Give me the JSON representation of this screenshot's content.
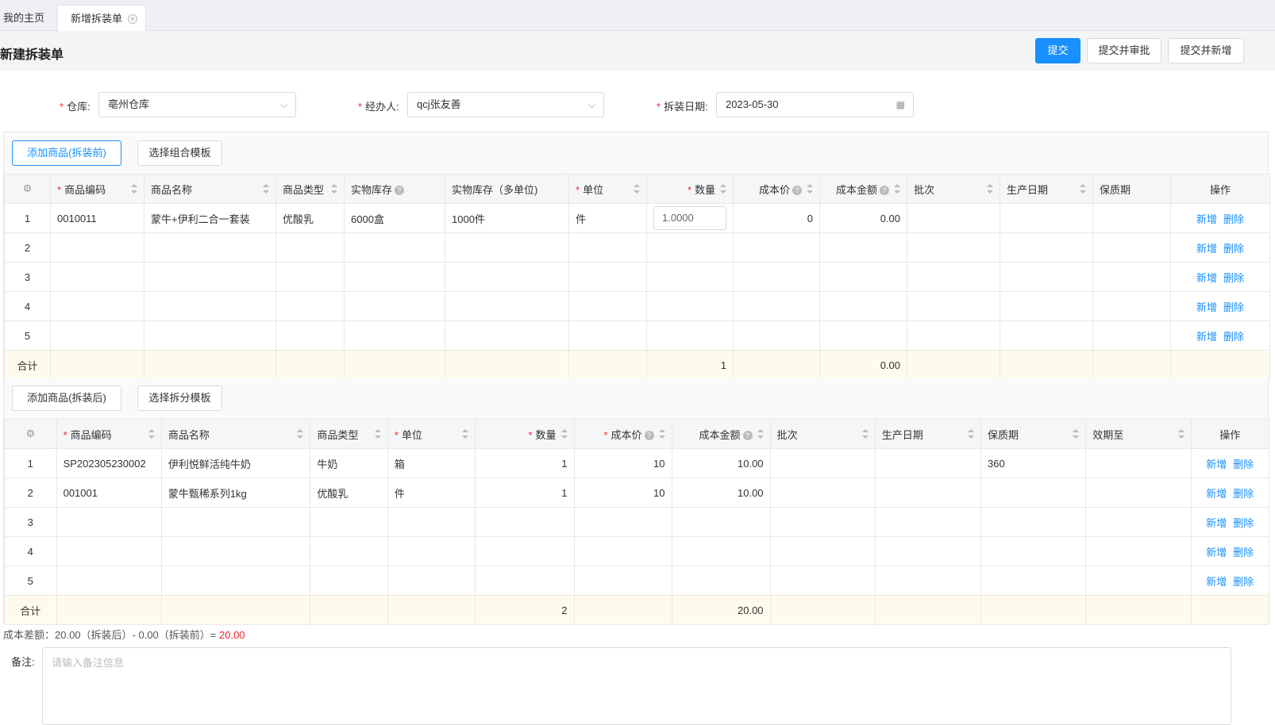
{
  "tabs": [
    {
      "label": "我的主页"
    },
    {
      "label": "新增拆装单"
    }
  ],
  "header": {
    "title": "新建拆装单",
    "buttons": {
      "submit": "提交",
      "submit_approve": "提交并审批",
      "submit_new": "提交并新增"
    }
  },
  "form": {
    "warehouse": {
      "label": "仓库:",
      "value": "亳州仓库"
    },
    "handler": {
      "label": "经办人:",
      "value": "qcj张友善"
    },
    "date": {
      "label": "拆装日期:",
      "value": "2023-05-30"
    }
  },
  "before": {
    "add_button": "添加商品(拆装前)",
    "template_button": "选择组合模板",
    "columns": [
      "商品编码",
      "商品名称",
      "商品类型",
      "实物库存",
      "实物库存（多单位)",
      "单位",
      "数量",
      "成本价",
      "成本金额",
      "批次",
      "生产日期",
      "保质期",
      "操作"
    ],
    "rows": [
      {
        "no": "1",
        "code": "0010011",
        "name": "蒙牛+伊利二合一套装",
        "type": "优酸乳",
        "stock": "6000盒",
        "stock_multi": "1000件",
        "unit": "件",
        "qty": "1.0000",
        "price": "0",
        "amount": "0.00"
      },
      {
        "no": "2"
      },
      {
        "no": "3"
      },
      {
        "no": "4"
      },
      {
        "no": "5"
      }
    ],
    "total": {
      "label": "合计",
      "qty": "1",
      "amount": "0.00"
    }
  },
  "after": {
    "add_button": "添加商品(拆装后)",
    "template_button": "选择拆分模板",
    "columns": [
      "商品编码",
      "商品名称",
      "商品类型",
      "单位",
      "数量",
      "成本价",
      "成本金额",
      "批次",
      "生产日期",
      "保质期",
      "效期至",
      "操作"
    ],
    "rows": [
      {
        "no": "1",
        "code": "SP202305230002",
        "name": "伊利悦鲜活纯牛奶",
        "type": "牛奶",
        "unit": "箱",
        "qty": "1",
        "price": "10",
        "amount": "10.00",
        "shelf": "360"
      },
      {
        "no": "2",
        "code": "001001",
        "name": "蒙牛甄稀系列1kg",
        "type": "优酸乳",
        "unit": "件",
        "qty": "1",
        "price": "10",
        "amount": "10.00",
        "shelf": ""
      },
      {
        "no": "3"
      },
      {
        "no": "4"
      },
      {
        "no": "5"
      }
    ],
    "total": {
      "label": "合计",
      "qty": "2",
      "amount": "20.00"
    }
  },
  "row_actions": {
    "add": "新增",
    "delete": "删除"
  },
  "cost_diff": {
    "text": "成本差额：20.00（拆装后）- 0.00（拆装前）=",
    "result": "20.00"
  },
  "remark": {
    "label": "备注:",
    "placeholder": "请输入备注信息"
  },
  "colors": {
    "primary": "#1890ff",
    "required": "#f5222d",
    "sum_row": "#fffbec"
  }
}
